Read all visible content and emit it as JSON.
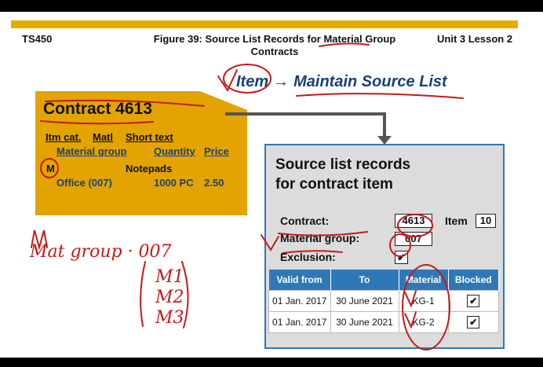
{
  "header": {
    "left": "TS450",
    "center_line1": "Figure 39: Source List Records for Material Group",
    "center_line2": "Contracts",
    "right": "Unit 3 Lesson 2"
  },
  "nav": {
    "item": "Item",
    "arrow": "→",
    "action": "Maintain Source List"
  },
  "contract": {
    "title": "Contract 4613",
    "col1": "Itm cat.",
    "col2": "Matl",
    "col3": "Short text",
    "col4": "Material group",
    "col5": "Quantity",
    "col6": "Price",
    "itm_cat": "M",
    "short_text": "Notepads",
    "material_group": "Office (007)",
    "quantity": "1000 PC",
    "price": "2.50"
  },
  "source_list": {
    "title_line1": "Source list records",
    "title_line2": "for contract item",
    "contract_label": "Contract:",
    "contract_value": "4613",
    "item_label": "Item",
    "item_value": "10",
    "material_group_label": "Material group:",
    "material_group_value": "007",
    "exclusion_label": "Exclusion:",
    "exclusion_mark": "✔",
    "table": {
      "headers": [
        "Valid from",
        "To",
        "Material",
        "Blocked"
      ],
      "rows": [
        [
          "01 Jan. 2017",
          "30 June 2021",
          "KG-1",
          "✔"
        ],
        [
          "01 Jan. 2017",
          "30 June 2021",
          "KG-2",
          "✔"
        ]
      ]
    }
  },
  "handwriting": {
    "line1": "Mat group · 007",
    "items": [
      "M1",
      "M2",
      "M3"
    ]
  }
}
